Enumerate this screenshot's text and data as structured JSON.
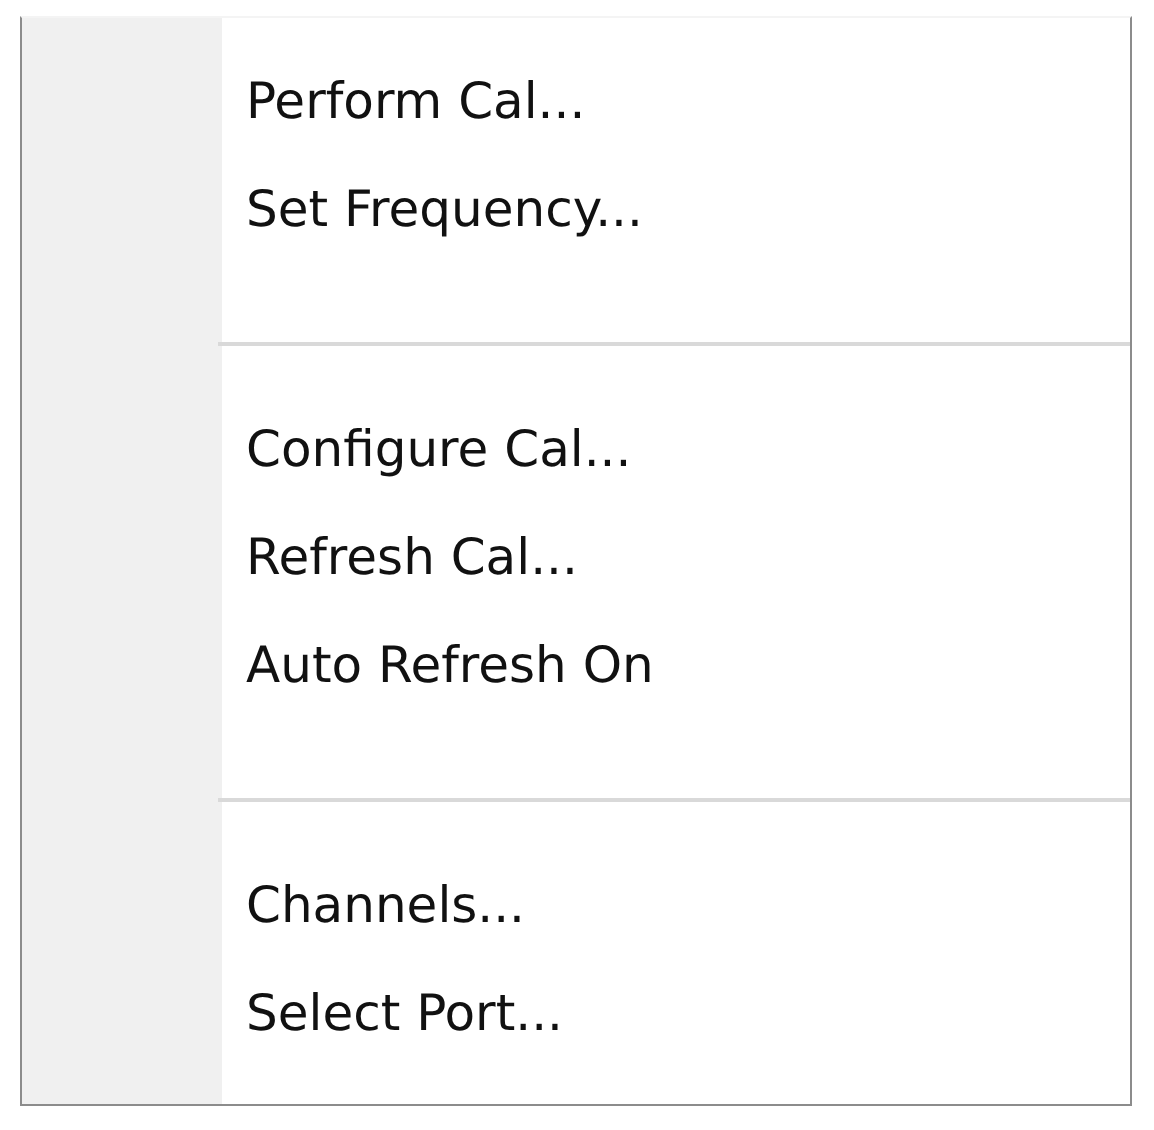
{
  "menu": {
    "groups": [
      {
        "items": [
          {
            "label": "Perform Cal..."
          },
          {
            "label": "Set Frequency..."
          }
        ]
      },
      {
        "items": [
          {
            "label": "Configure Cal..."
          },
          {
            "label": "Refresh Cal..."
          },
          {
            "label": "Auto Refresh On"
          }
        ]
      },
      {
        "items": [
          {
            "label": "Channels..."
          },
          {
            "label": "Select Port..."
          }
        ]
      }
    ]
  }
}
